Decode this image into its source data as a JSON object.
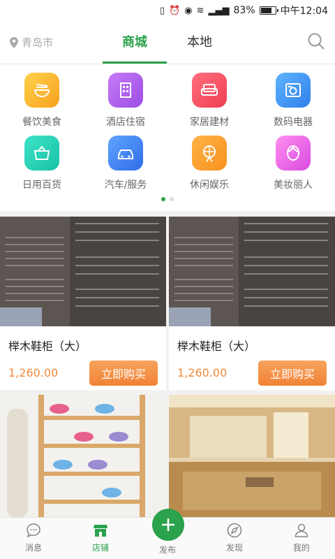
{
  "status_bar": {
    "battery": "83%",
    "time": "中午12:04",
    "battery_level": 0.83,
    "network": "4G"
  },
  "header": {
    "location": "青岛市",
    "tabs": [
      {
        "label": "商城",
        "active": true
      },
      {
        "label": "本地",
        "active": false
      }
    ],
    "accent_color": "#2ba24c"
  },
  "categories": [
    {
      "label": "餐饮美食",
      "icon": "bowl-icon"
    },
    {
      "label": "酒店住宿",
      "icon": "building-icon"
    },
    {
      "label": "家居建材",
      "icon": "sofa-icon"
    },
    {
      "label": "数码电器",
      "icon": "appliance-icon"
    },
    {
      "label": "日用百货",
      "icon": "basket-icon"
    },
    {
      "label": "汽车/服务",
      "icon": "car-icon"
    },
    {
      "label": "休闲娱乐",
      "icon": "ferris-wheel-icon"
    },
    {
      "label": "美妆丽人",
      "icon": "woman-face-icon"
    }
  ],
  "pager": {
    "pages": 2,
    "current": 1
  },
  "products": [
    {
      "title": "榉木鞋柜（大）",
      "price": "1,260.00",
      "buy_label": "立即购买"
    },
    {
      "title": "榉木鞋柜（大）",
      "price": "1,260.00",
      "buy_label": "立即购买"
    },
    {
      "title": "",
      "price": "",
      "buy_label": ""
    },
    {
      "title": "",
      "price": "",
      "buy_label": ""
    }
  ],
  "bottom_nav": [
    {
      "label": "消息",
      "icon": "message-icon"
    },
    {
      "label": "店铺",
      "icon": "store-icon",
      "active": true
    },
    {
      "label": "发布",
      "icon": "plus-icon"
    },
    {
      "label": "发现",
      "icon": "compass-icon"
    },
    {
      "label": "我的",
      "icon": "user-icon"
    }
  ]
}
